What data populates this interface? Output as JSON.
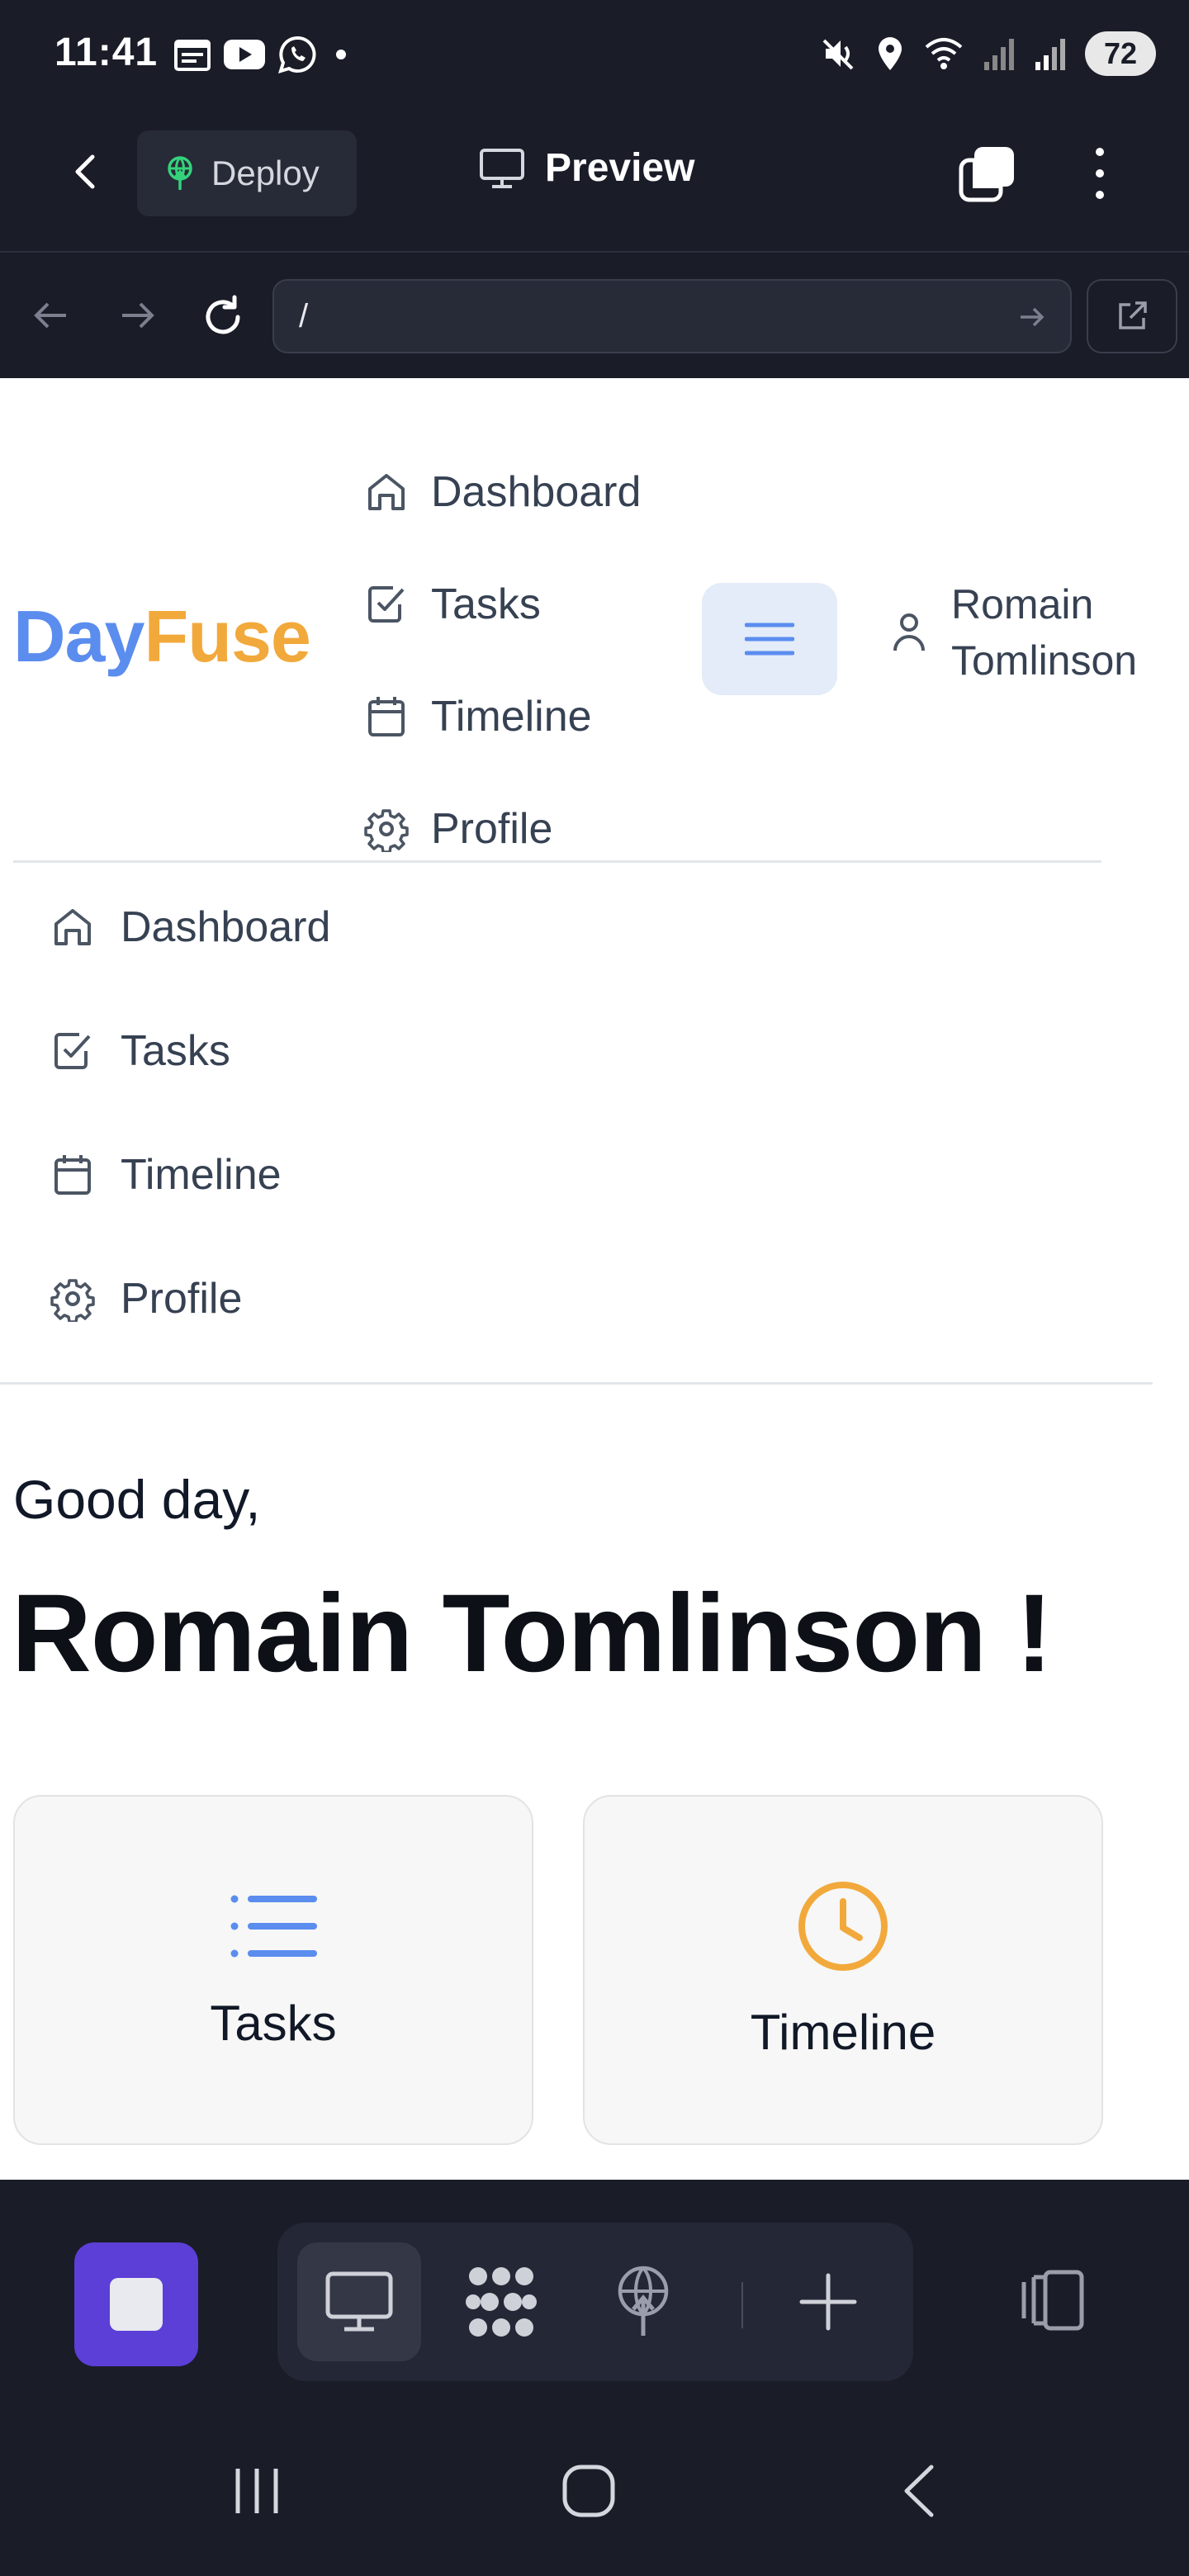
{
  "status_bar": {
    "time": "11:41",
    "left_icons": [
      "calendar-icon",
      "youtube-icon",
      "whatsapp-icon",
      "dot-icon"
    ],
    "right_icons": [
      "mute-icon",
      "location-icon",
      "wifi-icon",
      "signal-icon",
      "signal-icon"
    ],
    "battery": "72"
  },
  "app_header": {
    "deploy_label": "Deploy",
    "preview_label": "Preview"
  },
  "url_bar": {
    "url": "/"
  },
  "site": {
    "logo_part1": "Day",
    "logo_part2": "Fuse",
    "logo_colors": {
      "day": "#5b8def",
      "fuse": "#f2a93b"
    },
    "top_nav": [
      {
        "label": "Dashboard",
        "icon": "home-icon"
      },
      {
        "label": "Tasks",
        "icon": "checkbox-icon"
      },
      {
        "label": "Timeline",
        "icon": "calendar-icon"
      },
      {
        "label": "Profile",
        "icon": "gear-icon"
      }
    ],
    "user_name_line1": "Romain",
    "user_name_line2": "Tomlinson",
    "side_nav": [
      {
        "label": "Dashboard",
        "icon": "home-icon"
      },
      {
        "label": "Tasks",
        "icon": "checkbox-icon"
      },
      {
        "label": "Timeline",
        "icon": "calendar-icon"
      },
      {
        "label": "Profile",
        "icon": "gear-icon"
      }
    ],
    "greeting": "Good day,",
    "user_full_name": "Romain Tomlinson !",
    "cards": [
      {
        "label": "Tasks",
        "icon": "list-icon",
        "color": "#5b8def"
      },
      {
        "label": "Timeline",
        "icon": "clock-icon",
        "color": "#f2a93b"
      }
    ]
  },
  "bottom_toolbar": {
    "stop_color": "#5b3fd6",
    "tools": [
      "monitor-icon",
      "grid-icon",
      "deploy-icon",
      "plus-icon"
    ],
    "active_tool": "monitor-icon"
  }
}
